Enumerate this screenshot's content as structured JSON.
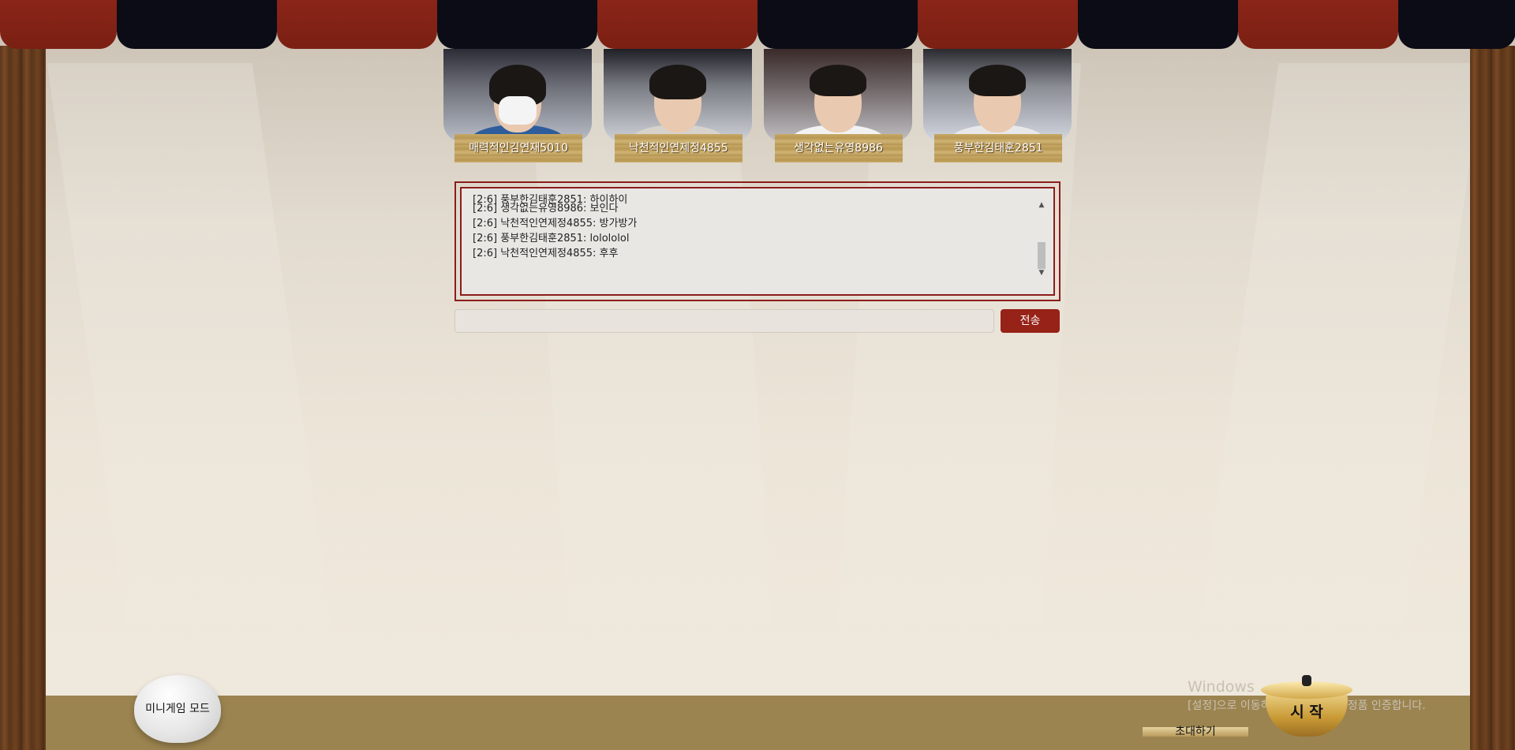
{
  "players": [
    {
      "name": "매력적인김연재5010",
      "mask": true
    },
    {
      "name": "낙천적인연제정4855",
      "mask": false
    },
    {
      "name": "생각없는유영8986",
      "mask": false
    },
    {
      "name": "풍부한김태훈2851",
      "mask": false
    }
  ],
  "chat": {
    "cut_line": "[2:6] 풍부한김태훈2851: 하이하이",
    "lines": [
      "[2:6] 생각없는유영8986: 보인다",
      "[2:6] 낙천적인연제정4855: 방가방가",
      "[2:6] 풍부한김태훈2851: lolololol",
      "[2:6] 낙천적인연제정4855: 후후"
    ]
  },
  "input": {
    "value": "",
    "send_label": "전송"
  },
  "buttons": {
    "minigame": "미니게임 모드",
    "start": "시 작",
    "invite": "초대하기"
  },
  "watermark": {
    "title": "Windows",
    "subtitle": "[설정]으로 이동하여 Windows를 정품 인증합니다."
  },
  "colors": {
    "accent": "#962218",
    "curtain_red": "#7a2013",
    "curtain_navy": "#0c0c16"
  }
}
